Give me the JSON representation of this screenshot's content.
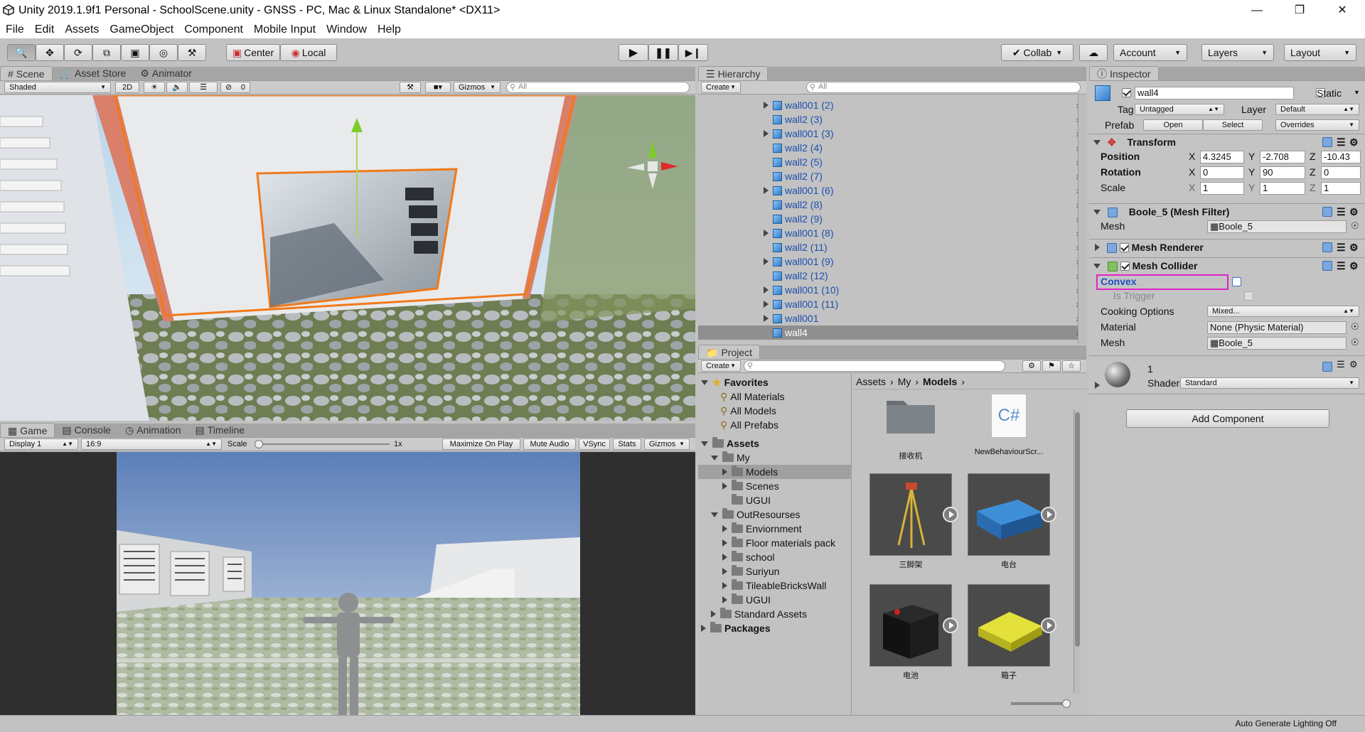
{
  "window": {
    "title": "Unity 2019.1.9f1 Personal - SchoolScene.unity - GNSS - PC, Mac & Linux Standalone* <DX11>"
  },
  "menu": [
    "File",
    "Edit",
    "Assets",
    "GameObject",
    "Component",
    "Mobile Input",
    "Window",
    "Help"
  ],
  "toolbar": {
    "center": "Center",
    "local": "Local",
    "collab": "Collab",
    "account": "Account",
    "layers": "Layers",
    "layout": "Layout"
  },
  "scene": {
    "tabs": [
      "Scene",
      "Asset Store",
      "Animator"
    ],
    "shading": "Shaded",
    "mode2d": "2D",
    "fx_count": "0",
    "gizmos": "Gizmos",
    "search_placeholder": "All"
  },
  "game": {
    "tabs": [
      "Game",
      "Console",
      "Animation",
      "Timeline"
    ],
    "display": "Display 1",
    "aspect": "16:9",
    "scale_label": "Scale",
    "scale_value": "1x",
    "buttons": [
      "Maximize On Play",
      "Mute Audio",
      "VSync",
      "Stats",
      "Gizmos"
    ]
  },
  "hierarchy": {
    "tab": "Hierarchy",
    "create": "Create",
    "search_placeholder": "All",
    "items": [
      {
        "name": "wall001 (2)",
        "expandable": true
      },
      {
        "name": "wall2 (3)",
        "expandable": false
      },
      {
        "name": "wall001 (3)",
        "expandable": true
      },
      {
        "name": "wall2 (4)",
        "expandable": false
      },
      {
        "name": "wall2 (5)",
        "expandable": false
      },
      {
        "name": "wall2 (7)",
        "expandable": false
      },
      {
        "name": "wall001 (6)",
        "expandable": true
      },
      {
        "name": "wall2 (8)",
        "expandable": false
      },
      {
        "name": "wall2 (9)",
        "expandable": false
      },
      {
        "name": "wall001 (8)",
        "expandable": true
      },
      {
        "name": "wall2 (11)",
        "expandable": false
      },
      {
        "name": "wall001 (9)",
        "expandable": true
      },
      {
        "name": "wall2 (12)",
        "expandable": false
      },
      {
        "name": "wall001 (10)",
        "expandable": true
      },
      {
        "name": "wall001 (11)",
        "expandable": true
      },
      {
        "name": "wall001",
        "expandable": true
      },
      {
        "name": "wall4",
        "expandable": false,
        "selected": true
      }
    ]
  },
  "project": {
    "tab": "Project",
    "create": "Create",
    "favorites_label": "Favorites",
    "favorites": [
      "All Materials",
      "All Models",
      "All Prefabs"
    ],
    "assets_label": "Assets",
    "tree": [
      {
        "name": "My",
        "level": 1,
        "open": true
      },
      {
        "name": "Models",
        "level": 2,
        "selected": true
      },
      {
        "name": "Scenes",
        "level": 2
      },
      {
        "name": "UGUI",
        "level": 2,
        "leaf": true
      },
      {
        "name": "OutResourses",
        "level": 1,
        "open": true
      },
      {
        "name": "Enviornment",
        "level": 2
      },
      {
        "name": "Floor materials pack",
        "level": 2
      },
      {
        "name": "school",
        "level": 2
      },
      {
        "name": "Suriyun",
        "level": 2
      },
      {
        "name": "TileableBricksWall",
        "level": 2
      },
      {
        "name": "UGUI",
        "level": 2
      },
      {
        "name": "Standard Assets",
        "level": 1
      }
    ],
    "packages_label": "Packages",
    "breadcrumb": [
      "Assets",
      "My",
      "Models"
    ],
    "assets": [
      {
        "name": "接收机",
        "kind": "folder"
      },
      {
        "name": "NewBehaviourScr...",
        "kind": "script",
        "icon_text": "C#"
      },
      {
        "name": "三脚架",
        "kind": "tripod"
      },
      {
        "name": "电台",
        "kind": "radio"
      },
      {
        "name": "电池",
        "kind": "battery"
      },
      {
        "name": "箱子",
        "kind": "box"
      }
    ]
  },
  "inspector": {
    "tab": "Inspector",
    "object_name": "wall4",
    "static_label": "Static",
    "tag_label": "Tag",
    "tag_value": "Untagged",
    "layer_label": "Layer",
    "layer_value": "Default",
    "prefab_label": "Prefab",
    "open_label": "Open",
    "select_label": "Select",
    "overrides_label": "Overrides",
    "transform": {
      "title": "Transform",
      "position_label": "Position",
      "position": {
        "x": "4.3245",
        "y": "-2.708",
        "z": "-10.43"
      },
      "rotation_label": "Rotation",
      "rotation": {
        "x": "0",
        "y": "90",
        "z": "0"
      },
      "scale_label": "Scale",
      "scale": {
        "x": "1",
        "y": "1",
        "z": "1"
      }
    },
    "mesh_filter": {
      "title": "Boole_5 (Mesh Filter)",
      "mesh_label": "Mesh",
      "mesh_value": "Boole_5"
    },
    "mesh_renderer": {
      "title": "Mesh Renderer"
    },
    "mesh_collider": {
      "title": "Mesh Collider",
      "convex_label": "Convex",
      "is_trigger_label": "Is Trigger",
      "cooking_label": "Cooking Options",
      "cooking_value": "Mixed...",
      "material_label": "Material",
      "material_value": "None (Physic Material)",
      "mesh_label": "Mesh",
      "mesh_value": "Boole_5"
    },
    "material": {
      "name": "1",
      "shader_label": "Shader",
      "shader_value": "Standard"
    },
    "add_component": "Add Component"
  },
  "status": {
    "text": "Auto Generate Lighting Off"
  }
}
